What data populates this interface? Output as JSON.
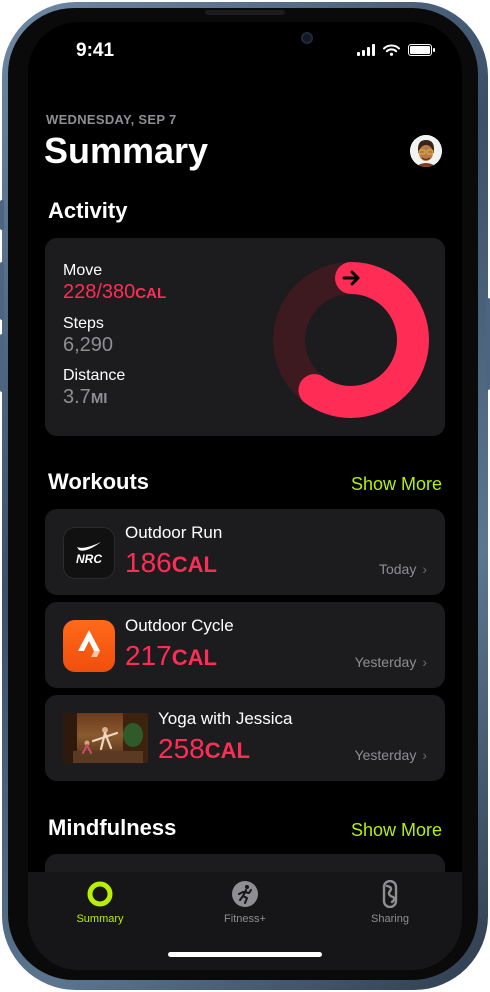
{
  "status_bar": {
    "time": "9:41"
  },
  "header": {
    "date": "WEDNESDAY, SEP 7",
    "title": "Summary"
  },
  "activity": {
    "section_title": "Activity",
    "move": {
      "label": "Move",
      "value": "228/380",
      "unit": "CAL"
    },
    "steps": {
      "label": "Steps",
      "value": "6,290"
    },
    "distance": {
      "label": "Distance",
      "value": "3.7",
      "unit": "MI"
    },
    "ring_progress": 0.6,
    "colors": {
      "move": "#ff2d55"
    }
  },
  "workouts": {
    "section_title": "Workouts",
    "show_more": "Show More",
    "items": [
      {
        "name": "Outdoor Run",
        "value": "186",
        "unit": "CAL",
        "date": "Today",
        "icon": "nrc-logo-icon",
        "icon_text": "NRC"
      },
      {
        "name": "Outdoor Cycle",
        "value": "217",
        "unit": "CAL",
        "date": "Yesterday",
        "icon": "strava-logo-icon"
      },
      {
        "name": "Yoga with Jessica",
        "value": "258",
        "unit": "CAL",
        "date": "Yesterday",
        "icon": "yoga-thumbnail"
      }
    ]
  },
  "mindfulness": {
    "section_title": "Mindfulness",
    "show_more": "Show More"
  },
  "tabbar": {
    "items": [
      {
        "label": "Summary",
        "icon": "activity-ring-icon",
        "active": true
      },
      {
        "label": "Fitness+",
        "icon": "runner-icon",
        "active": false
      },
      {
        "label": "Sharing",
        "icon": "sharing-icon",
        "active": false
      }
    ]
  },
  "colors": {
    "accent": "#b7f000",
    "calories": "#ff2d55",
    "secondary_text": "#8e8e93"
  }
}
